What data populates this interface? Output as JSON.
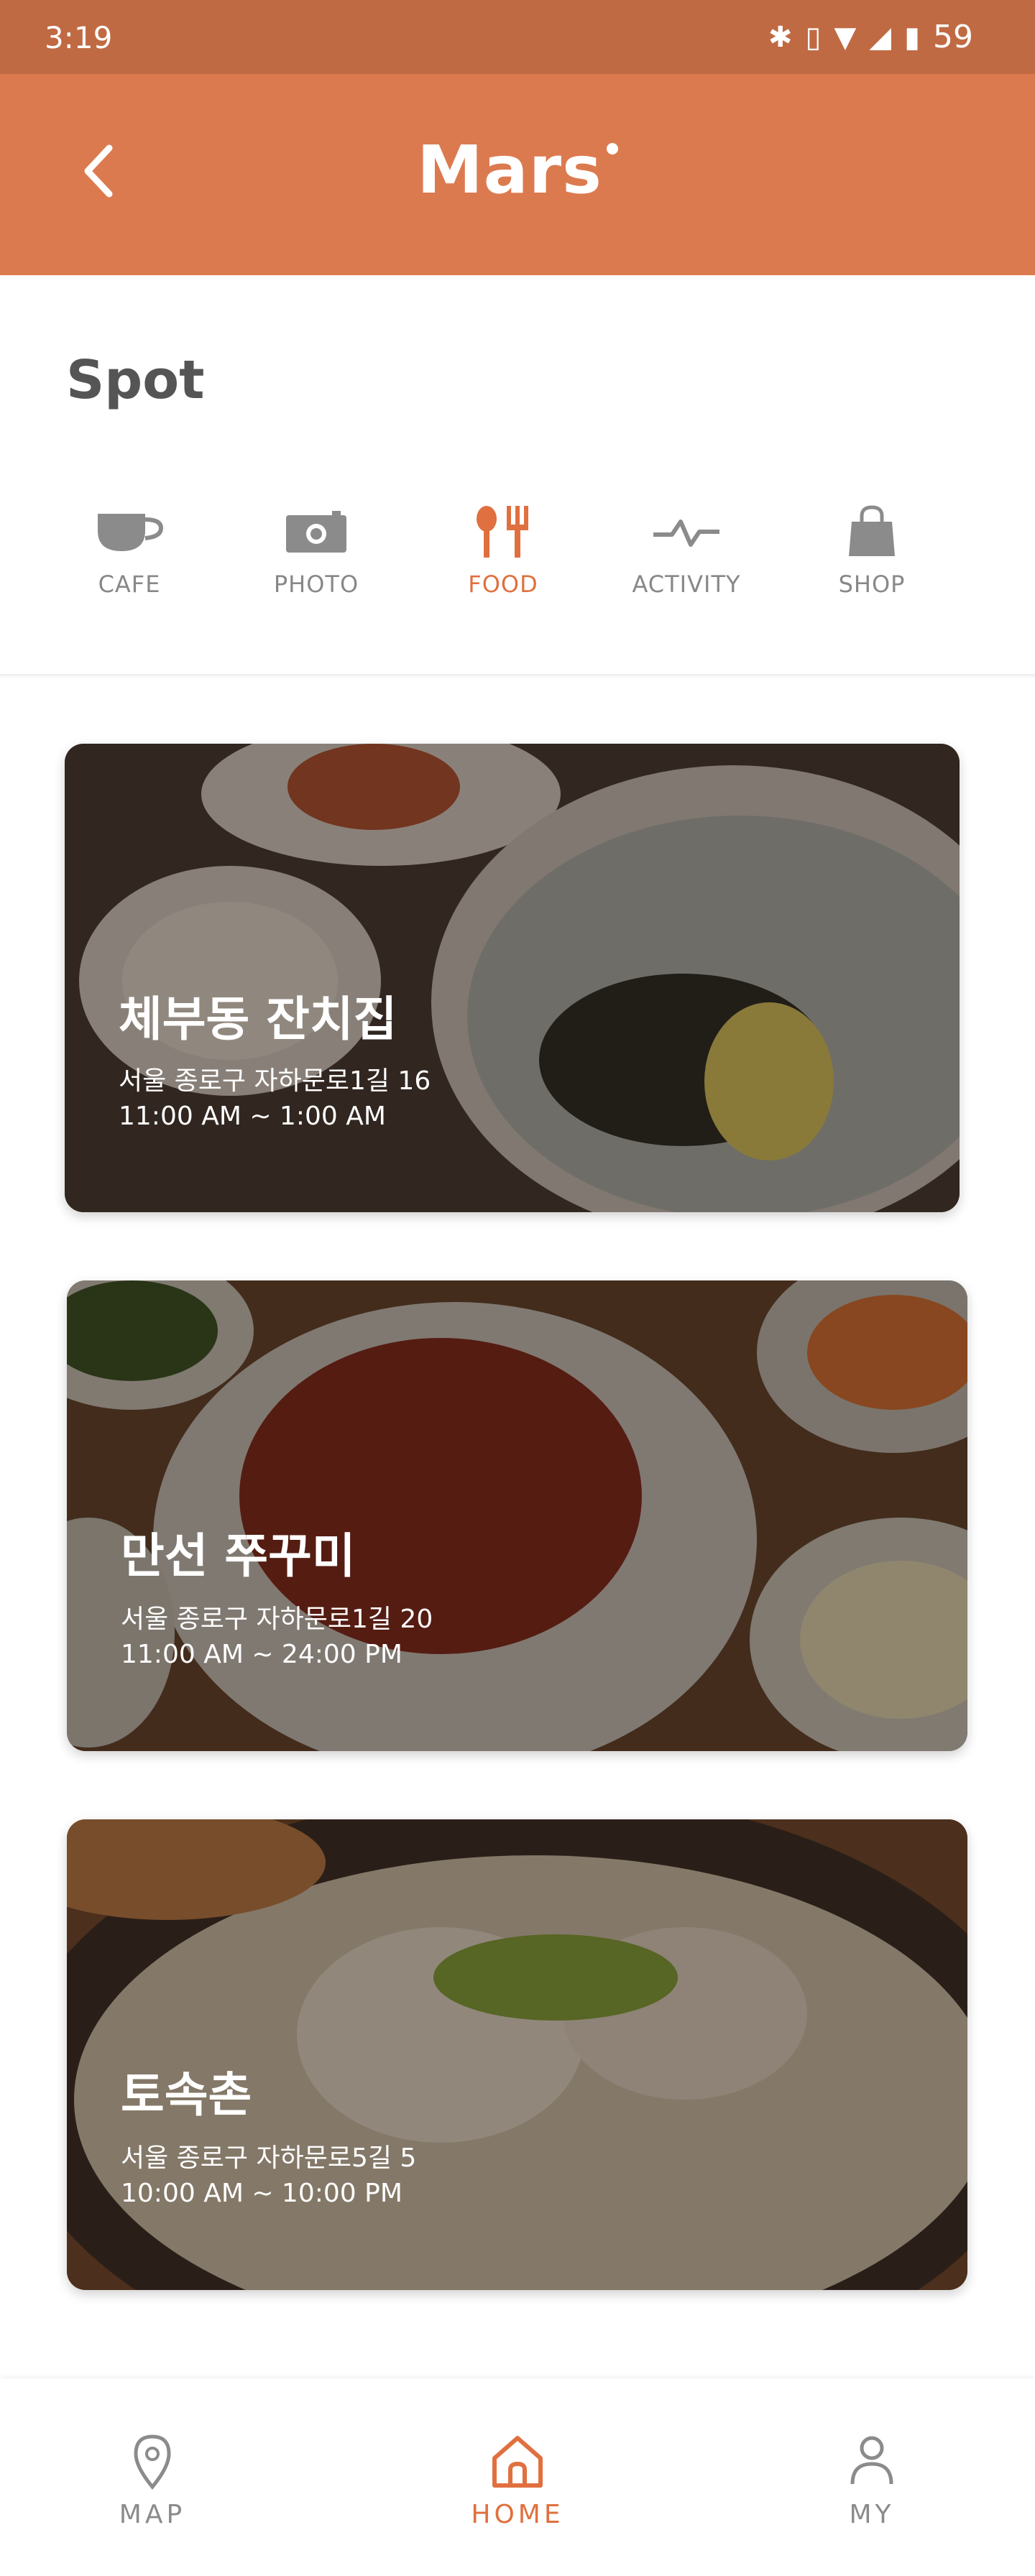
{
  "status_bar": {
    "time": "3:19",
    "battery": "59"
  },
  "header": {
    "title": "Mars"
  },
  "spot": {
    "title": "Spot"
  },
  "categories": [
    {
      "label": "CAFE",
      "icon": "cup-icon"
    },
    {
      "label": "PHOTO",
      "icon": "camera-icon"
    },
    {
      "label": "FOOD",
      "icon": "fork-knife-icon",
      "active": true
    },
    {
      "label": "ACTIVITY",
      "icon": "pulse-icon"
    },
    {
      "label": "SHOP",
      "icon": "bag-icon"
    }
  ],
  "places": [
    {
      "name": "체부동 잔치집",
      "address": "서울 종로구 자하문로1길 16",
      "hours": "11:00 AM ~ 1:00 AM"
    },
    {
      "name": "만선 쭈꾸미",
      "address": "서울 종로구 자하문로1길 20",
      "hours": "11:00 AM ~ 24:00 PM"
    },
    {
      "name": "토속촌",
      "address": "서울 종로구 자하문로5길 5",
      "hours": "10:00 AM ~ 10:00 PM"
    }
  ],
  "bottom_nav": [
    {
      "label": "MAP",
      "icon": "map-pin-icon"
    },
    {
      "label": "HOME",
      "icon": "home-icon",
      "active": true
    },
    {
      "label": "MY",
      "icon": "user-icon"
    }
  ],
  "colors": {
    "accent": "#dc7a4f",
    "active": "#e0703f",
    "inactive": "#888888"
  }
}
